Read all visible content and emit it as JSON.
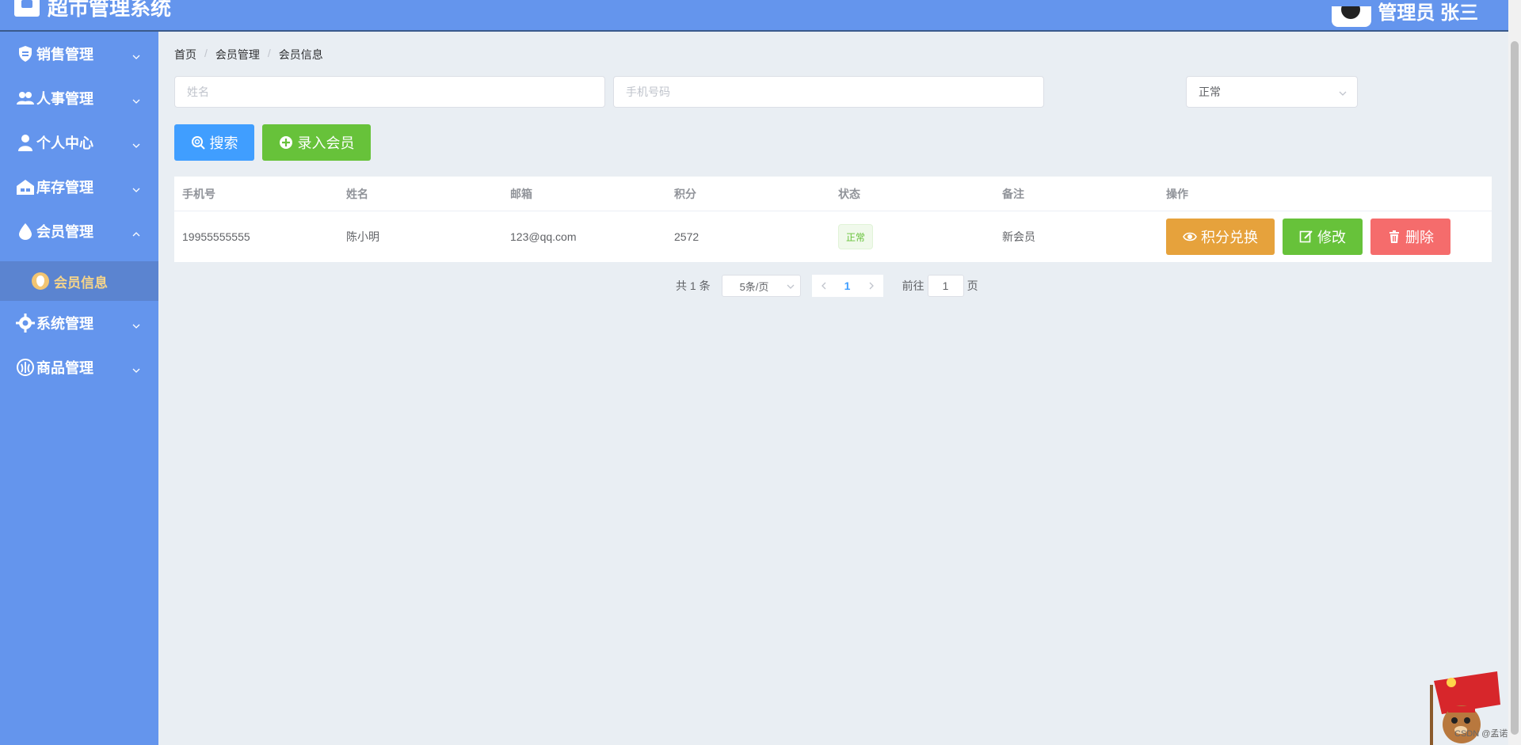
{
  "app": {
    "title": "超市管理系统",
    "user_label": "管理员 张三"
  },
  "sidebar": {
    "items": [
      {
        "label": "销售管理"
      },
      {
        "label": "人事管理"
      },
      {
        "label": "个人中心"
      },
      {
        "label": "库存管理"
      },
      {
        "label": "会员管理",
        "expanded": true
      },
      {
        "label": "系统管理"
      },
      {
        "label": "商品管理"
      }
    ],
    "active_sub": {
      "label": "会员信息"
    }
  },
  "breadcrumb": {
    "items": [
      "首页",
      "会员管理",
      "会员信息"
    ],
    "separator": "/"
  },
  "filters": {
    "name_placeholder": "姓名",
    "phone_placeholder": "手机号码",
    "status_value": "正常"
  },
  "toolbar": {
    "search_label": "搜索",
    "add_label": "录入会员"
  },
  "table": {
    "columns": [
      "手机号",
      "姓名",
      "邮箱",
      "积分",
      "状态",
      "备注",
      "操作"
    ],
    "rows": [
      {
        "phone": "19955555555",
        "name": "陈小明",
        "email": "123@qq.com",
        "points": "2572",
        "status": "正常",
        "note": "新会员",
        "actions": [
          "积分兑换",
          "修改",
          "删除"
        ]
      }
    ]
  },
  "pagination": {
    "total_text": "共 1 条",
    "page_size": "5条/页",
    "current_page": "1",
    "goto_label": "前往",
    "goto_value": "1",
    "page_suffix": "页"
  },
  "watermark": "CSDN @孟诺",
  "colors": {
    "primary": "#409eff",
    "success": "#67c23a",
    "warning": "#e6a23c",
    "danger": "#f56c6c",
    "sidebar": "#6495ed"
  }
}
